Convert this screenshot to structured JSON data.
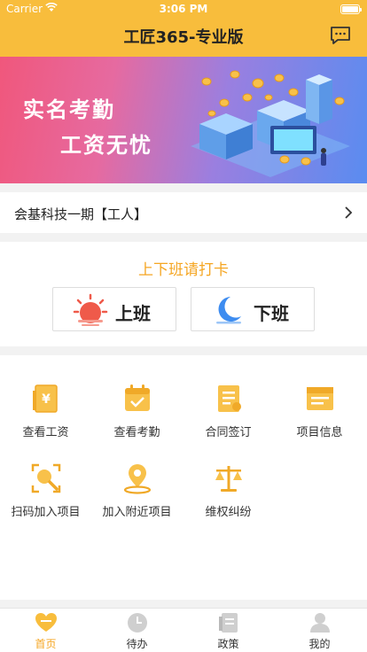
{
  "status_bar": {
    "carrier": "Carrier",
    "time": "3:06 PM"
  },
  "nav": {
    "title": "工匠365-专业版",
    "message_icon": "message-icon"
  },
  "banner": {
    "line1": "实名考勤",
    "line2": "工资无忧"
  },
  "project": {
    "name": "会基科技一期【工人】"
  },
  "punch": {
    "hint": "上下班请打卡",
    "on_label": "上班",
    "off_label": "下班"
  },
  "menu": [
    {
      "label": "查看工资",
      "icon": "salary-icon"
    },
    {
      "label": "查看考勤",
      "icon": "attendance-icon"
    },
    {
      "label": "合同签订",
      "icon": "contract-icon"
    },
    {
      "label": "项目信息",
      "icon": "project-info-icon"
    },
    {
      "label": "扫码加入项目",
      "icon": "scan-icon"
    },
    {
      "label": "加入附近项目",
      "icon": "location-icon"
    },
    {
      "label": "维权纠纷",
      "icon": "scales-icon"
    }
  ],
  "tabs": [
    {
      "label": "首页",
      "icon": "home-icon",
      "active": true
    },
    {
      "label": "待办",
      "icon": "clock-icon",
      "active": false
    },
    {
      "label": "政策",
      "icon": "policy-icon",
      "active": false
    },
    {
      "label": "我的",
      "icon": "profile-icon",
      "active": false
    }
  ],
  "colors": {
    "accent": "#f8bd3c",
    "orange": "#f5a623",
    "sun": "#ef5a4a",
    "moon": "#3d8cf0"
  }
}
